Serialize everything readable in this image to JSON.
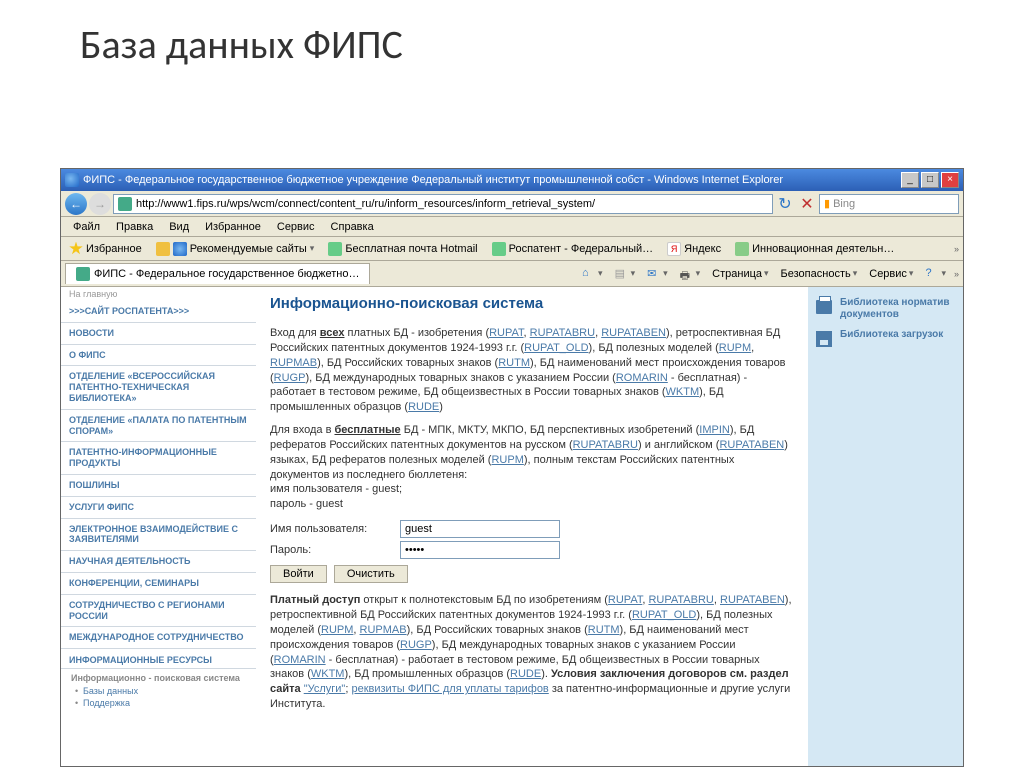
{
  "slide_title": "База данных ФИПС",
  "window_title": "ФИПС - Федеральное государственное бюджетное учреждение Федеральный институт промышленной собст - Windows Internet Explorer",
  "url": "http://www1.fips.ru/wps/wcm/connect/content_ru/ru/inform_resources/inform_retrieval_system/",
  "search_provider": "Bing",
  "menus": [
    "Файл",
    "Правка",
    "Вид",
    "Избранное",
    "Сервис",
    "Справка"
  ],
  "favorites_label": "Избранное",
  "fav_items": [
    "Рекомендуемые сайты",
    "Бесплатная почта Hotmail",
    "Роспатент - Федеральный…",
    "Яндекс",
    "Инновационная деятельн…"
  ],
  "tab_label": "ФИПС - Федеральное государственное бюджетно…",
  "toolbar": {
    "home": "",
    "page": "Страница",
    "safety": "Безопасность",
    "service": "Сервис"
  },
  "sidebar": {
    "top": "На главную",
    "items": [
      ">>>САЙТ РОСПАТЕНТА>>>",
      "НОВОСТИ",
      "О ФИПС",
      "ОТДЕЛЕНИЕ «ВСЕРОССИЙСКАЯ ПАТЕНТНО-ТЕХНИЧЕСКАЯ БИБЛИОТЕКА»",
      "ОТДЕЛЕНИЕ «ПАЛАТА ПО ПАТЕНТНЫМ СПОРАМ»",
      "ПАТЕНТНО-ИНФОРМАЦИОННЫЕ ПРОДУКТЫ",
      "ПОШЛИНЫ",
      "УСЛУГИ ФИПС",
      "ЭЛЕКТРОННОЕ ВЗАИМОДЕЙСТВИЕ С ЗАЯВИТЕЛЯМИ",
      "НАУЧНАЯ ДЕЯТЕЛЬНОСТЬ",
      "КОНФЕРЕНЦИИ, СЕМИНАРЫ",
      "СОТРУДНИЧЕСТВО С РЕГИОНАМИ РОССИИ",
      "МЕЖДУНАРОДНОЕ СОТРУДНИЧЕСТВО"
    ],
    "section_header": "ИНФОРМАЦИОННЫЕ РЕСУРСЫ",
    "active_sub": "Информационно - поисковая система",
    "bullets": [
      "Базы данных",
      "Поддержка"
    ]
  },
  "content": {
    "heading": "Информационно-поисковая система",
    "para1_pre": "Вход для ",
    "para1_b1": "всех",
    "para1_mid1": " платных БД - изобретения (",
    "links1": [
      "RUPAT",
      "RUPATABRU",
      "RUPATABEN"
    ],
    "para1_mid2": "), ретроспективная БД Российских патентных документов 1924-1993 г.г. (",
    "links2": [
      "RUPAT_OLD"
    ],
    "para1_mid3": "), БД полезных моделей (",
    "links3": [
      "RUPM",
      "RUPMAB"
    ],
    "para1_mid4": "), БД Российских товарных знаков (",
    "links4": [
      "RUTM"
    ],
    "para1_mid5": "), БД наименований мест происхождения товаров (",
    "links5": [
      "RUGP"
    ],
    "para1_mid6": "), БД международных товарных знаков с указанием России (",
    "links6": [
      "ROMARIN"
    ],
    "para1_mid7": " - бесплатная) - работает в тестовом режиме, БД общеизвестных в России товарных знаков (",
    "links7": [
      "WKTM"
    ],
    "para1_mid8": "), БД промышленных образцов (",
    "links8": [
      "RUDE"
    ],
    "para1_end": ")",
    "para2_pre": "Для входа в ",
    "para2_b1": "бесплатные",
    "para2_txt": " БД - МПК, МКТУ, МКПО, БД перспективных изобретений (",
    "links9": [
      "IMPIN"
    ],
    "para2_mid1": "), БД рефератов Российских патентных документов на русском (",
    "links10": [
      "RUPATABRU"
    ],
    "para2_mid2": ") и английском (",
    "links11": [
      "RUPATABEN"
    ],
    "para2_mid3": ") языках, БД рефератов полезных моделей (",
    "links12": [
      "RUPM"
    ],
    "para2_mid4": "), полным текстам Российских патентных документов из последнего бюллетеня:",
    "cred_user": "имя пользователя - guest;",
    "cred_pass": "пароль - guest",
    "form": {
      "user_label": "Имя пользователя:",
      "user_value": "guest",
      "pass_label": "Пароль:",
      "pass_value": "•••••",
      "submit": "Войти",
      "clear": "Очистить"
    },
    "para3_b": "Платный доступ",
    "para3_txt": " открыт к полнотекстовым БД по изобретениям (",
    "plinks1": [
      "RUPAT",
      "RUPATABRU",
      "RUPATABEN"
    ],
    "para3_mid1": "), ретроспективной БД Российских патентных документов 1924-1993 г.г. (",
    "plinks2": [
      "RUPAT_OLD"
    ],
    "para3_mid2": "), БД полезных моделей (",
    "plinks3": [
      "RUPM",
      "RUPMAB"
    ],
    "para3_mid3": "), БД Российских товарных знаков (",
    "plinks4": [
      "RUTM"
    ],
    "para3_mid4": "), БД наименований мест происхождения товаров (",
    "plinks5": [
      "RUGP"
    ],
    "para3_mid5": "), БД международных товарных знаков с указанием России (",
    "plinks6": [
      "ROMARIN"
    ],
    "para3_mid6": " - бесплатная) - работает в тестовом режиме, БД общеизвестных в России товарных знаков (",
    "plinks7": [
      "WKTM"
    ],
    "para3_mid7": "), БД промышленных образцов (",
    "plinks8": [
      "RUDE"
    ],
    "para3_mid8": "). ",
    "para3_b2": "Условия заключения договоров см. раздел сайта ",
    "uslugi": "\"Услуги\"",
    "para3_end1": "; ",
    "rekvizity": "реквизиты ФИПС для уплаты тарифов",
    "para3_end2": " за патентно-информационные и другие услуги Института."
  },
  "rightbar": {
    "item1": "Библиотека норматив документов",
    "item2": "Библиотека загрузок"
  }
}
